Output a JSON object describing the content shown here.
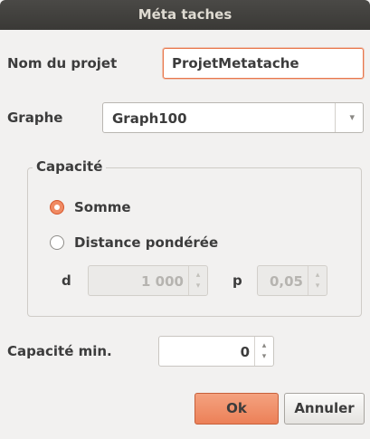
{
  "window": {
    "title": "Méta taches"
  },
  "form": {
    "project_name_label": "Nom du projet",
    "project_name_value": "ProjetMetatache",
    "graph_label": "Graphe",
    "graph_selected": "Graph100",
    "capacity_group_title": "Capacité",
    "options": {
      "sum_label": "Somme",
      "weighted_distance_label": "Distance pondérée",
      "selected": "Somme"
    },
    "d_label": "d",
    "d_value": "1 000",
    "p_label": "p",
    "p_value": "0,05",
    "min_capacity_label": "Capacité min.",
    "min_capacity_value": "0"
  },
  "buttons": {
    "ok": "Ok",
    "cancel": "Annuler"
  },
  "colors": {
    "accent": "#f08a63",
    "titlebar": "#3c3b37"
  },
  "icons": {
    "spin_up": "▴",
    "spin_down": "▾",
    "combo_arrow": "▾"
  }
}
